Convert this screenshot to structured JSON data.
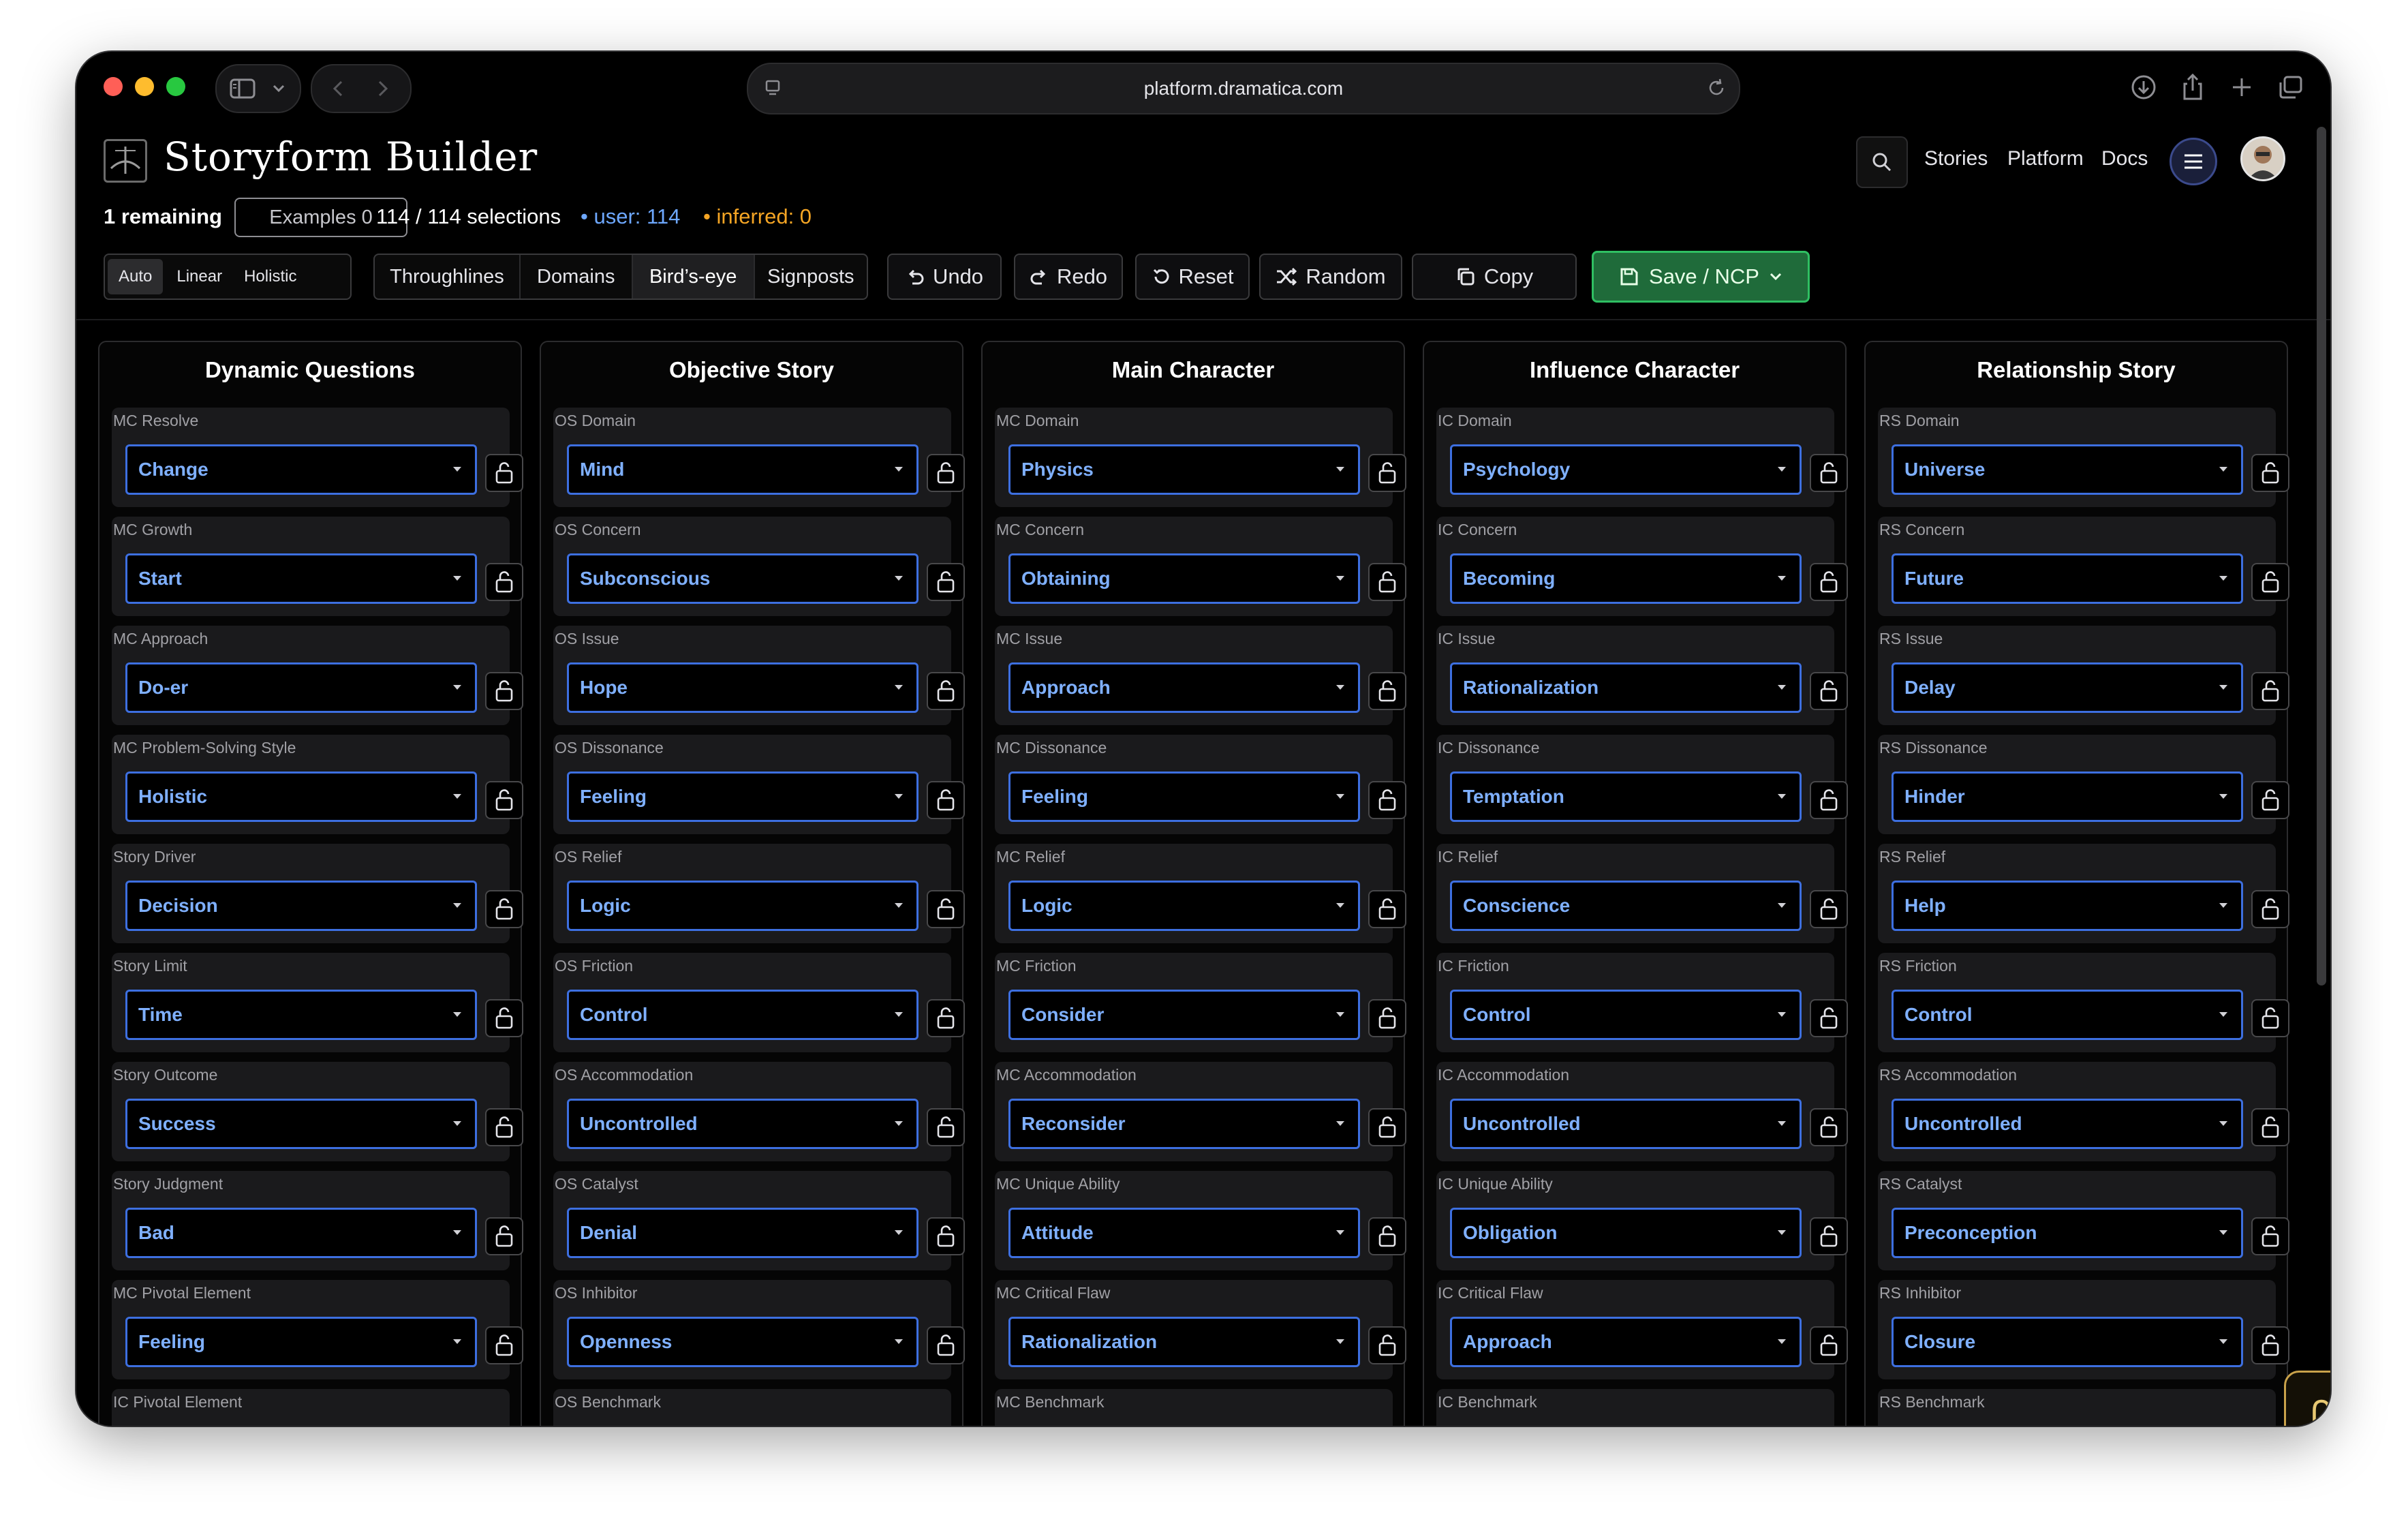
{
  "browser": {
    "url": "platform.dramatica.com"
  },
  "app": {
    "title": "Storyform Builder",
    "nav": [
      "Stories",
      "Platform",
      "Docs"
    ]
  },
  "stats": {
    "remaining": "1 remaining",
    "examples": "Examples 0",
    "selections": "114 / 114 selections",
    "user": "• user: 114",
    "inferred": "• inferred: 0"
  },
  "toolbar": {
    "modes": [
      "Auto",
      "Linear",
      "Holistic"
    ],
    "views": [
      "Throughlines",
      "Domains",
      "Bird’s-eye",
      "Signposts"
    ],
    "undo": "Undo",
    "redo": "Redo",
    "reset": "Reset",
    "random": "Random",
    "copy": "Copy",
    "save": "Save / NCP"
  },
  "columns": [
    {
      "title": "Dynamic Questions",
      "fields": [
        {
          "label": "MC Resolve",
          "value": "Change"
        },
        {
          "label": "MC Growth",
          "value": "Start"
        },
        {
          "label": "MC Approach",
          "value": "Do-er"
        },
        {
          "label": "MC Problem-Solving Style",
          "value": "Holistic"
        },
        {
          "label": "Story Driver",
          "value": "Decision"
        },
        {
          "label": "Story Limit",
          "value": "Time"
        },
        {
          "label": "Story Outcome",
          "value": "Success"
        },
        {
          "label": "Story Judgment",
          "value": "Bad"
        },
        {
          "label": "MC Pivotal Element",
          "value": "Feeling"
        },
        {
          "label": "IC Pivotal Element",
          "value": ""
        }
      ]
    },
    {
      "title": "Objective Story",
      "fields": [
        {
          "label": "OS Domain",
          "value": "Mind"
        },
        {
          "label": "OS Concern",
          "value": "Subconscious"
        },
        {
          "label": "OS Issue",
          "value": "Hope"
        },
        {
          "label": "OS Dissonance",
          "value": "Feeling"
        },
        {
          "label": "OS Relief",
          "value": "Logic"
        },
        {
          "label": "OS Friction",
          "value": "Control"
        },
        {
          "label": "OS Accommodation",
          "value": "Uncontrolled"
        },
        {
          "label": "OS Catalyst",
          "value": "Denial"
        },
        {
          "label": "OS Inhibitor",
          "value": "Openness"
        },
        {
          "label": "OS Benchmark",
          "value": ""
        }
      ]
    },
    {
      "title": "Main Character",
      "fields": [
        {
          "label": "MC Domain",
          "value": "Physics"
        },
        {
          "label": "MC Concern",
          "value": "Obtaining"
        },
        {
          "label": "MC Issue",
          "value": "Approach"
        },
        {
          "label": "MC Dissonance",
          "value": "Feeling"
        },
        {
          "label": "MC Relief",
          "value": "Logic"
        },
        {
          "label": "MC Friction",
          "value": "Consider"
        },
        {
          "label": "MC Accommodation",
          "value": "Reconsider"
        },
        {
          "label": "MC Unique Ability",
          "value": "Attitude"
        },
        {
          "label": "MC Critical Flaw",
          "value": "Rationalization"
        },
        {
          "label": "MC Benchmark",
          "value": ""
        }
      ]
    },
    {
      "title": "Influence Character",
      "fields": [
        {
          "label": "IC Domain",
          "value": "Psychology"
        },
        {
          "label": "IC Concern",
          "value": "Becoming"
        },
        {
          "label": "IC Issue",
          "value": "Rationalization"
        },
        {
          "label": "IC Dissonance",
          "value": "Temptation"
        },
        {
          "label": "IC Relief",
          "value": "Conscience"
        },
        {
          "label": "IC Friction",
          "value": "Control"
        },
        {
          "label": "IC Accommodation",
          "value": "Uncontrolled"
        },
        {
          "label": "IC Unique Ability",
          "value": "Obligation"
        },
        {
          "label": "IC Critical Flaw",
          "value": "Approach"
        },
        {
          "label": "IC Benchmark",
          "value": ""
        }
      ]
    },
    {
      "title": "Relationship Story",
      "fields": [
        {
          "label": "RS Domain",
          "value": "Universe"
        },
        {
          "label": "RS Concern",
          "value": "Future"
        },
        {
          "label": "RS Issue",
          "value": "Delay"
        },
        {
          "label": "RS Dissonance",
          "value": "Hinder"
        },
        {
          "label": "RS Relief",
          "value": "Help"
        },
        {
          "label": "RS Friction",
          "value": "Control"
        },
        {
          "label": "RS Accommodation",
          "value": "Uncontrolled"
        },
        {
          "label": "RS Catalyst",
          "value": "Preconception"
        },
        {
          "label": "RS Inhibitor",
          "value": "Closure"
        },
        {
          "label": "RS Benchmark",
          "value": ""
        }
      ]
    }
  ],
  "colors": {
    "select_border": "#3d6fe0",
    "select_text": "#7fb0ff",
    "save_green": "#1f6b3a",
    "user_blue": "#6ea8ff",
    "inferred_orange": "#f5a524"
  }
}
